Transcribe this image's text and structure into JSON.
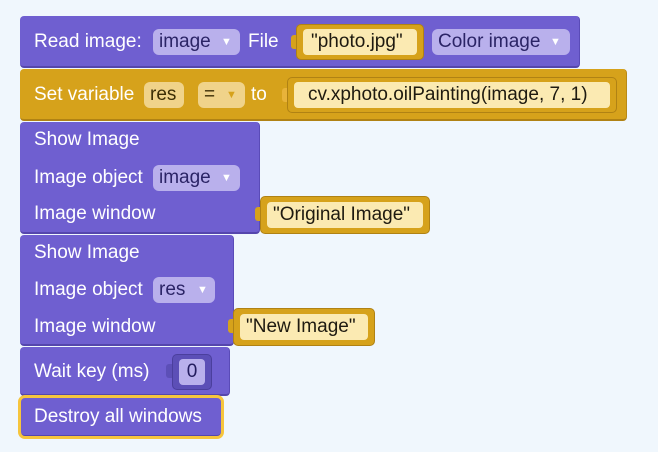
{
  "read_image": {
    "label": "Read image:",
    "var": "image",
    "file_label": "File",
    "file_value": "\"photo.jpg\"",
    "mode": "Color image"
  },
  "set_variable": {
    "label": "Set variable",
    "var": "res",
    "op": "=",
    "to_label": "to",
    "expr": "cv.xphoto.oilPainting(image, 7, 1)"
  },
  "show1": {
    "title": "Show Image",
    "obj_label": "Image object",
    "obj_var": "image",
    "win_label": "Image window",
    "win_value": "\"Original Image\""
  },
  "show2": {
    "title": "Show Image",
    "obj_label": "Image object",
    "obj_var": "res",
    "win_label": "Image window",
    "win_value": "\"New Image\""
  },
  "wait": {
    "label": "Wait key (ms)",
    "value": "0"
  },
  "destroy": {
    "label": "Destroy all windows"
  },
  "caret": "▼"
}
